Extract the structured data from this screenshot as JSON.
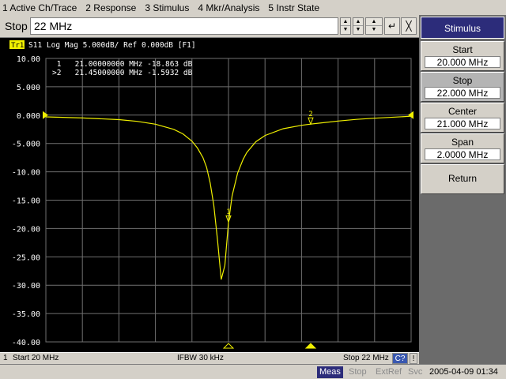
{
  "menu": [
    "1 Active Ch/Trace",
    "2 Response",
    "3 Stimulus",
    "4 Mkr/Analysis",
    "5 Instr State"
  ],
  "entry": {
    "label": "Stop",
    "value": "22 MHz",
    "enter_glyph": "↵",
    "close_glyph": "╳"
  },
  "trace": {
    "tag": "Tr1",
    "header": "S11  Log Mag 5.000dB/ Ref 0.000dB [F1]"
  },
  "markers": [
    {
      "line": " 1   21.00000000 MHz -18.863 dB",
      "label": "1"
    },
    {
      "line": ">2   21.45000000 MHz -1.5932 dB",
      "label": "2"
    }
  ],
  "colors": {
    "background": "#000000",
    "grid": "#707070",
    "trace": "#f0f000",
    "text": "#ffffff",
    "softkey_title_bg": "#2c2c7a"
  },
  "chart_data": {
    "type": "line",
    "xlim": [
      20.0,
      22.0
    ],
    "ylim": [
      -40,
      10
    ],
    "yticks": [
      "10.00",
      "5.000",
      "0.000",
      "-5.000",
      "-10.00",
      "-15.00",
      "-20.00",
      "-25.00",
      "-30.00",
      "-35.00",
      "-40.00"
    ],
    "ref_level": 0,
    "series": [
      {
        "x": [
          20.0,
          20.2,
          20.4,
          20.5,
          20.6,
          20.7,
          20.75,
          20.8,
          20.83,
          20.86,
          20.88,
          20.9,
          20.92,
          20.94,
          20.96,
          20.98,
          21.0,
          21.02,
          21.05,
          21.08,
          21.1,
          21.15,
          21.2,
          21.3,
          21.4,
          21.45,
          21.5,
          21.6,
          21.7,
          21.8,
          22.0
        ],
        "y": [
          -0.3,
          -0.5,
          -0.8,
          -1.1,
          -1.6,
          -2.5,
          -3.3,
          -4.6,
          -5.8,
          -7.5,
          -9.2,
          -12.0,
          -16.0,
          -22.0,
          -29.0,
          -26.5,
          -18.9,
          -14.2,
          -10.2,
          -7.8,
          -6.6,
          -4.7,
          -3.6,
          -2.4,
          -1.8,
          -1.59,
          -1.4,
          -1.05,
          -0.75,
          -0.55,
          -0.2
        ]
      }
    ],
    "markers": [
      {
        "id": "1",
        "x": 21.0,
        "y": -18.863
      },
      {
        "id": "2",
        "x": 21.45,
        "y": -1.5932
      }
    ]
  },
  "status": {
    "channel": "1",
    "start": "Start 20 MHz",
    "ifbw": "IFBW 30 kHz",
    "stop": "Stop 22 MHz",
    "cal": "C?",
    "excl": "!"
  },
  "bottom": {
    "meas": "Meas",
    "stop": "Stop",
    "extref": "ExtRef",
    "svc": "Svc",
    "datetime": "2005-04-09 01:34"
  },
  "softkeys": {
    "title": "Stimulus",
    "items": [
      {
        "label": "Start",
        "value": "20.000 MHz"
      },
      {
        "label": "Stop",
        "value": "22.000 MHz"
      },
      {
        "label": "Center",
        "value": "21.000 MHz"
      },
      {
        "label": "Span",
        "value": "2.0000 MHz"
      }
    ],
    "return_label": "Return"
  }
}
